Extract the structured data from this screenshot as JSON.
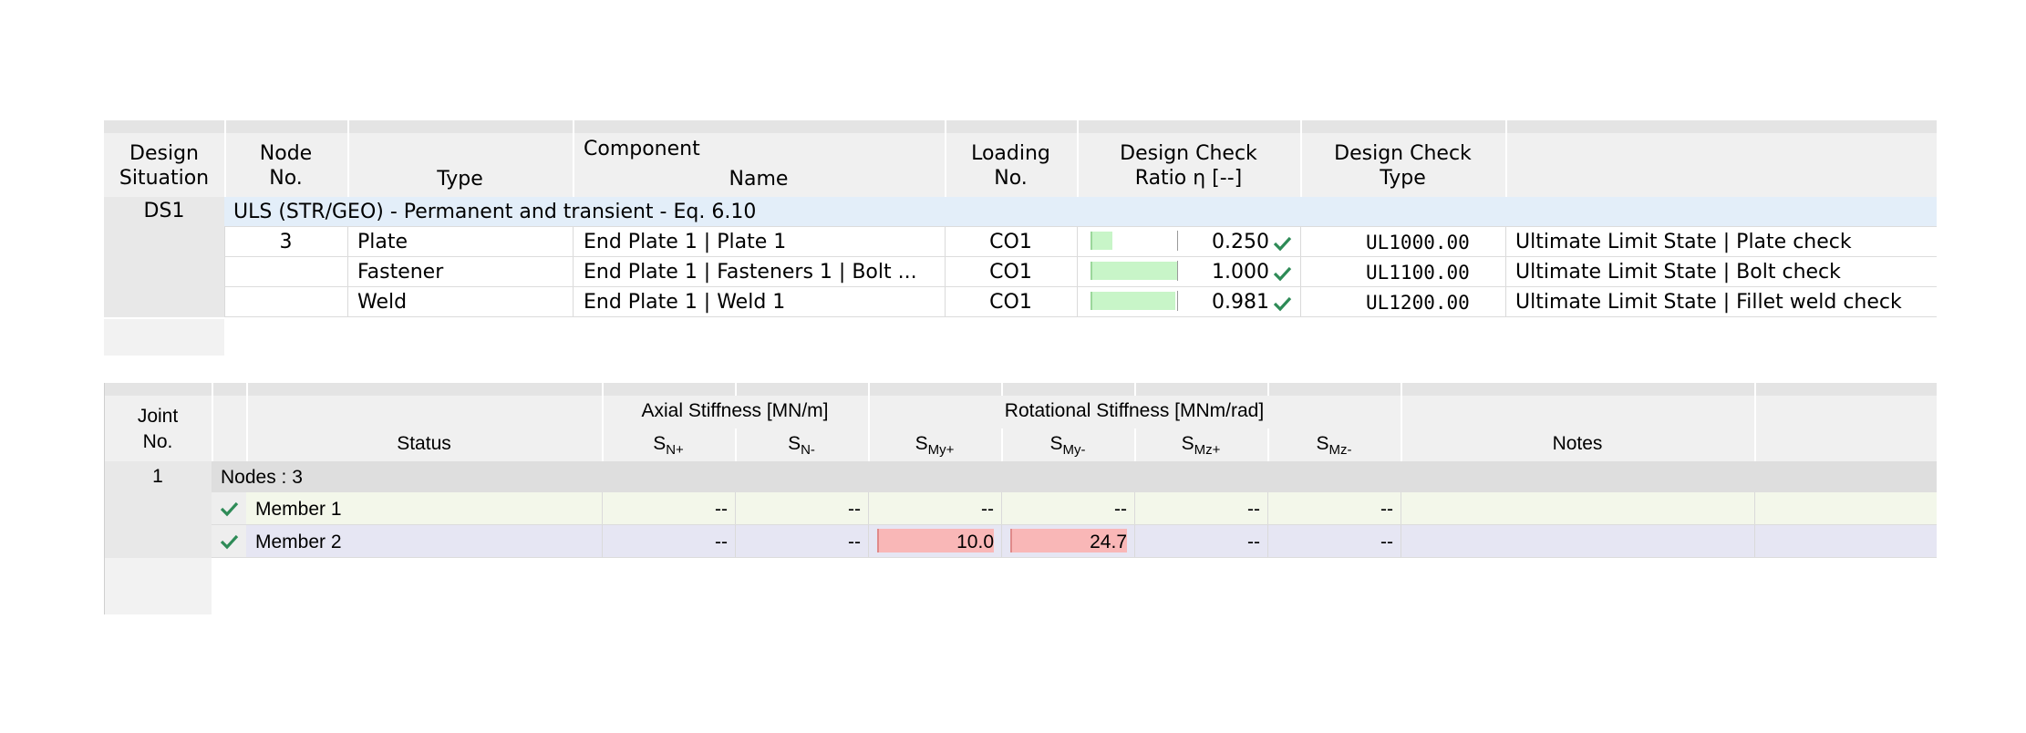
{
  "table1": {
    "headers": {
      "design_situation": [
        "Design",
        "Situation"
      ],
      "node_no": [
        "Node",
        "No."
      ],
      "component": "Component",
      "type": "Type",
      "name": "Name",
      "loading_no": [
        "Loading",
        "No."
      ],
      "ratio": [
        "Design Check",
        "Ratio η [--]"
      ],
      "check_type": [
        "Design Check",
        "Type"
      ]
    },
    "ds": "DS1",
    "group": "ULS (STR/GEO) - Permanent and transient - Eq. 6.10",
    "rows": [
      {
        "node": "3",
        "type": "Plate",
        "name": "End Plate 1 | Plate 1",
        "loading": "CO1",
        "ratio": "0.250",
        "ratio_value": 0.25,
        "check": "UL1000.00",
        "desc": "Ultimate Limit State | Plate check"
      },
      {
        "node": "",
        "type": "Fastener",
        "name": "End Plate 1 | Fasteners 1 | Bolt ...",
        "loading": "CO1",
        "ratio": "1.000",
        "ratio_value": 1.0,
        "check": "UL1100.00",
        "desc": "Ultimate Limit State | Bolt check"
      },
      {
        "node": "",
        "type": "Weld",
        "name": "End Plate 1 | Weld 1",
        "loading": "CO1",
        "ratio": "0.981",
        "ratio_value": 0.981,
        "check": "UL1200.00",
        "desc": "Ultimate Limit State | Fillet weld check"
      }
    ]
  },
  "table2": {
    "headers": {
      "joint_no": [
        "Joint",
        "No."
      ],
      "status": "Status",
      "axial": "Axial Stiffness [MN/m]",
      "rotational": "Rotational Stiffness [MNm/rad]",
      "notes": "Notes",
      "sub_cols": [
        {
          "s": "S",
          "sub": "N+"
        },
        {
          "s": "S",
          "sub": "N-"
        },
        {
          "s": "S",
          "sub": "My+"
        },
        {
          "s": "S",
          "sub": "My-"
        },
        {
          "s": "S",
          "sub": "Mz+"
        },
        {
          "s": "S",
          "sub": "Mz-"
        }
      ]
    },
    "joint": "1",
    "group": "Nodes : 3",
    "rows": [
      {
        "label": "Member 1",
        "values": [
          "--",
          "--",
          "--",
          "--",
          "--",
          "--"
        ],
        "highlight": [
          false,
          false,
          false,
          false,
          false,
          false
        ]
      },
      {
        "label": "Member 2",
        "values": [
          "--",
          "--",
          "10.0",
          "24.7",
          "--",
          "--"
        ],
        "highlight": [
          false,
          false,
          true,
          true,
          false,
          false
        ]
      }
    ]
  },
  "colors": {
    "group_row_1": "#e3eef9",
    "ratio_bar": "#c8f5c8",
    "check_ok": "#2e8b57",
    "row_member1": "#f3f7ea",
    "row_member2": "#e6e6f3",
    "group_row_2": "#dedede",
    "highlight": "#f9b7b7"
  }
}
